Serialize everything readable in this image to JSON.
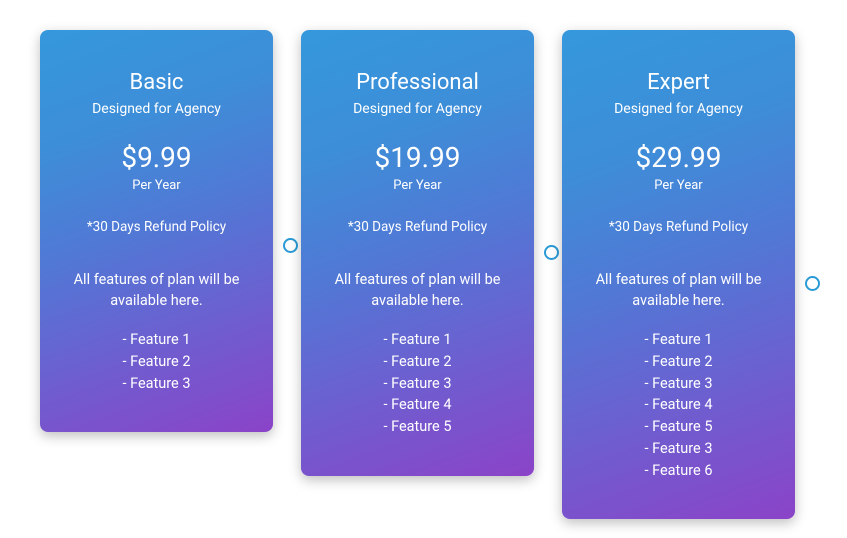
{
  "plans": [
    {
      "title": "Basic",
      "subtitle": "Designed for Agency",
      "price": "$9.99",
      "period": "Per Year",
      "refund": "*30 Days Refund Policy",
      "feature_intro": "All features of plan will be available here.",
      "features": [
        "- Feature 1",
        "- Feature 2",
        "- Feature 3"
      ]
    },
    {
      "title": "Professional",
      "subtitle": "Designed for Agency",
      "price": "$19.99",
      "period": "Per Year",
      "refund": "*30 Days Refund Policy",
      "feature_intro": "All features of plan will be available here.",
      "features": [
        "- Feature 1",
        "- Feature 2",
        "- Feature 3",
        "- Feature 4",
        "- Feature 5"
      ]
    },
    {
      "title": "Expert",
      "subtitle": "Designed for Agency",
      "price": "$29.99",
      "period": "Per Year",
      "refund": "*30 Days Refund Policy",
      "feature_intro": "All features of plan will be available here.",
      "features": [
        "- Feature 1",
        "- Feature 2",
        "- Feature 3",
        "- Feature 4",
        "- Feature 5",
        "- Feature 3",
        "- Feature 6"
      ]
    }
  ]
}
